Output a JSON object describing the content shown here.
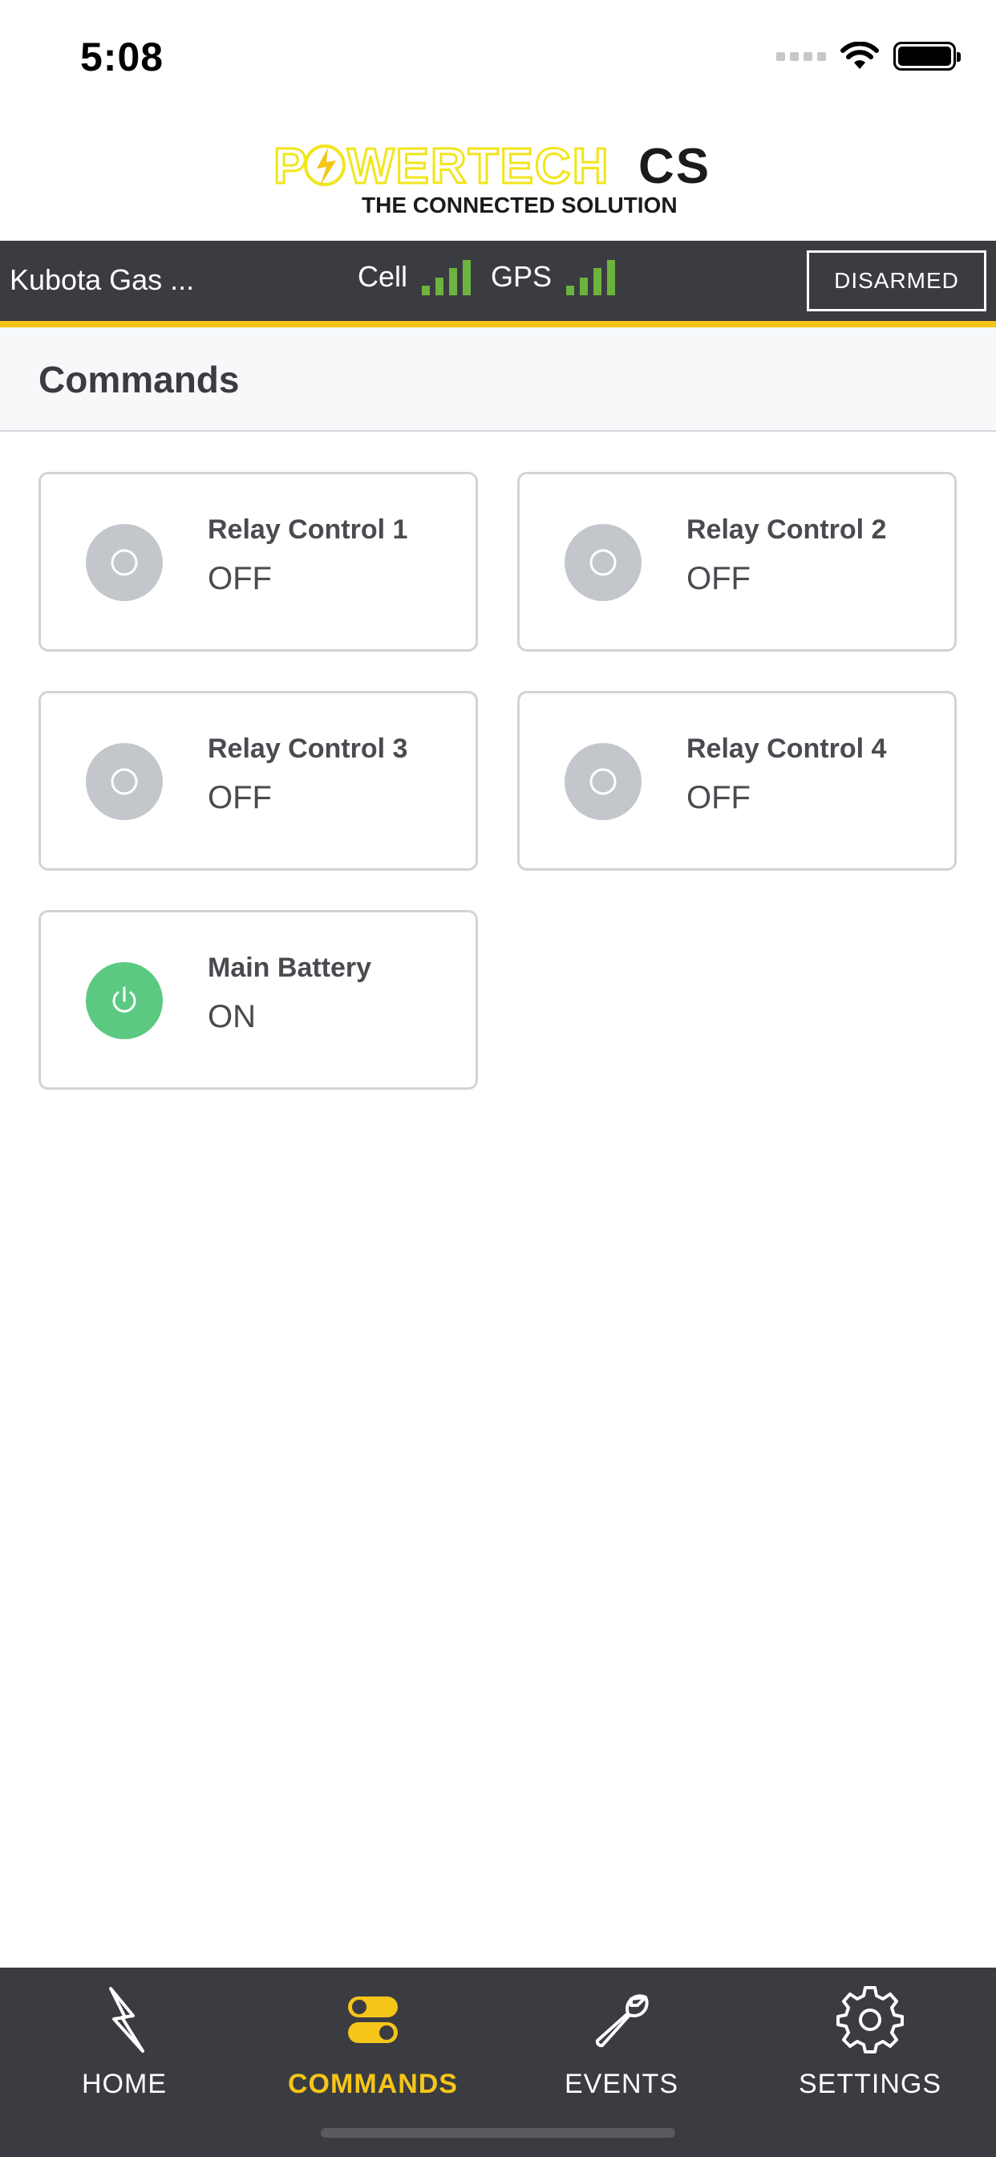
{
  "status_bar": {
    "time": "5:08"
  },
  "brand": {
    "logo_main_left": "P",
    "logo_main_mid": "WERTECH",
    "logo_main_right": "CS",
    "logo_tagline": "THE CONNECTED SOLUTION",
    "accent_color": "#f5c518"
  },
  "device_bar": {
    "device_name": "Kubota Gas ...",
    "cell_label": "Cell",
    "gps_label": "GPS",
    "arm_button_label": "DISARMED",
    "signal_color": "#6cb33f"
  },
  "page": {
    "title": "Commands"
  },
  "commands": [
    {
      "label": "Relay Control 1",
      "state": "OFF",
      "icon": "circle-icon"
    },
    {
      "label": "Relay Control 2",
      "state": "OFF",
      "icon": "circle-icon"
    },
    {
      "label": "Relay Control 3",
      "state": "OFF",
      "icon": "circle-icon"
    },
    {
      "label": "Relay Control 4",
      "state": "OFF",
      "icon": "circle-icon"
    },
    {
      "label": "Main Battery",
      "state": "ON",
      "icon": "power-icon"
    }
  ],
  "tabs": [
    {
      "label": "HOME",
      "icon": "lightning-icon",
      "active": false
    },
    {
      "label": "COMMANDS",
      "icon": "toggles-icon",
      "active": true
    },
    {
      "label": "EVENTS",
      "icon": "wrench-icon",
      "active": false
    },
    {
      "label": "SETTINGS",
      "icon": "gear-icon",
      "active": false
    }
  ]
}
